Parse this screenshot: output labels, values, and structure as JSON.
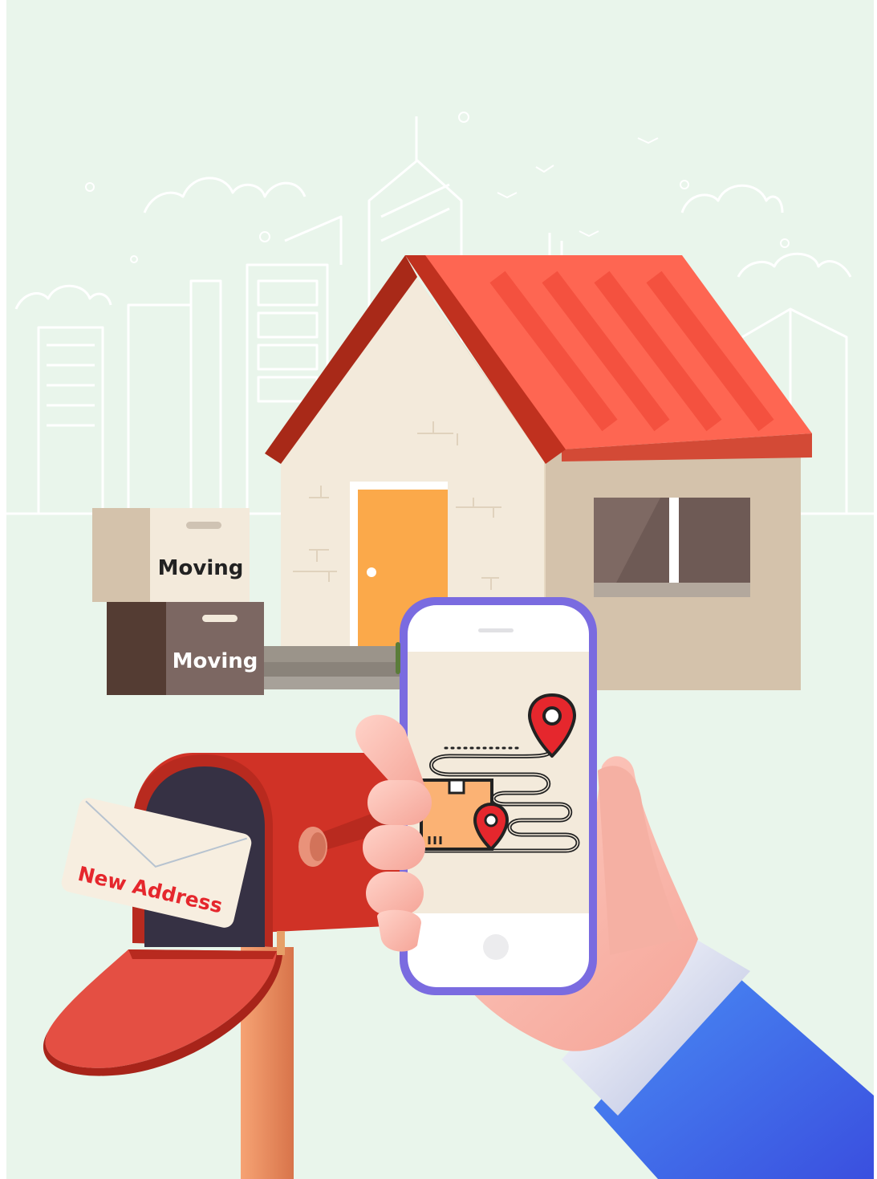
{
  "illustration": {
    "boxes": {
      "top_label": "Moving",
      "bottom_label": "Moving"
    },
    "envelope": {
      "label": "New Address"
    },
    "colors": {
      "background": "#e9f5eb",
      "roof": "#fe6652",
      "wall": "#f3eadb",
      "door": "#fba94a",
      "mailbox": "#d03226",
      "phone_frame": "#7a6be0",
      "sleeve": "#3a6ff0",
      "pin": "#e5272d"
    },
    "icons": [
      "city-skyline-icon",
      "house-icon",
      "moving-box-icon",
      "mailbox-icon",
      "envelope-icon",
      "smartphone-icon",
      "hand-icon",
      "location-pin-icon",
      "delivery-route-icon",
      "parcel-icon"
    ]
  }
}
